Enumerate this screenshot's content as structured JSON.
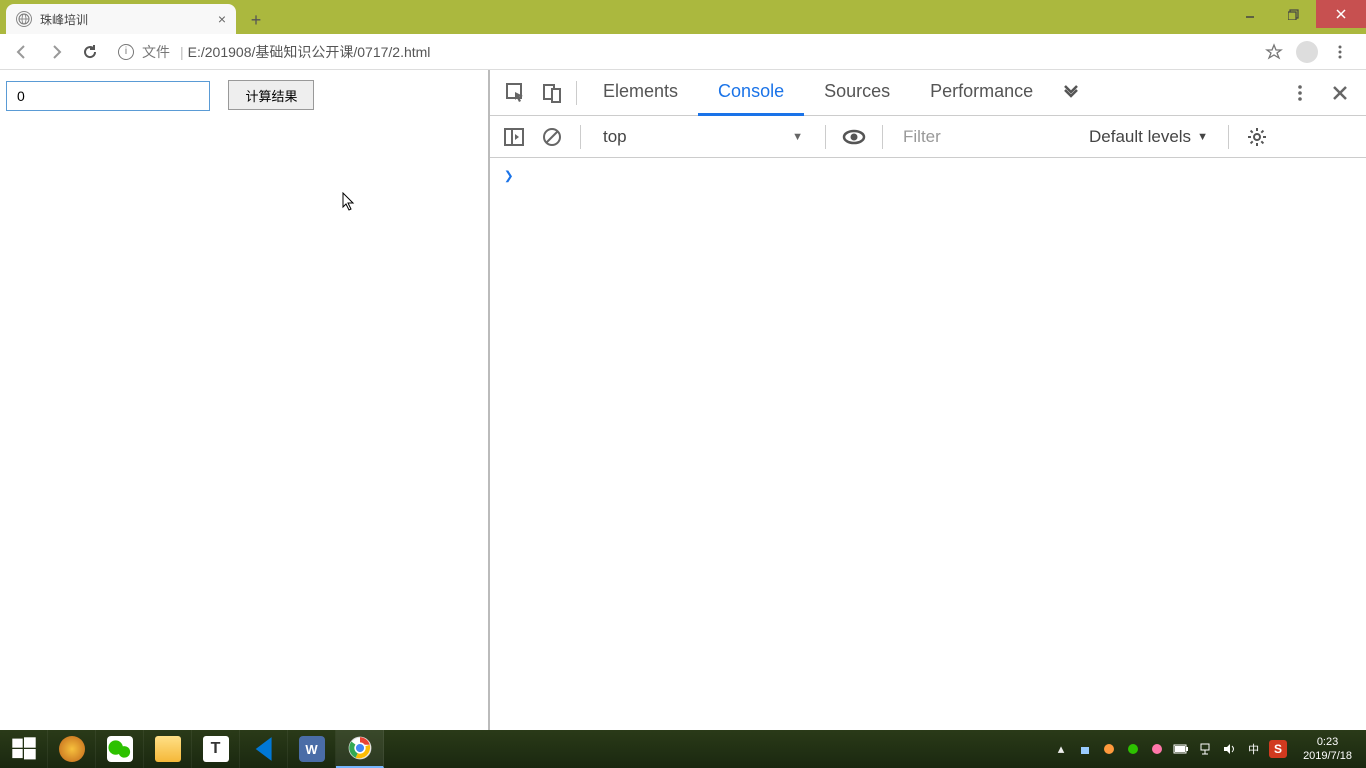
{
  "browser": {
    "tab_title": "珠峰培训",
    "url_label": "文件",
    "url_path": "E:/201908/基础知识公开课/0717/2.html"
  },
  "page": {
    "input_value": "0",
    "button_label": "计算结果"
  },
  "devtools": {
    "tabs": {
      "elements": "Elements",
      "console": "Console",
      "sources": "Sources",
      "performance": "Performance"
    },
    "context": "top",
    "filter_placeholder": "Filter",
    "levels": "Default levels"
  },
  "taskbar": {
    "ime": "中",
    "sogou": "S",
    "time": "0:23",
    "date": "2019/7/18"
  }
}
